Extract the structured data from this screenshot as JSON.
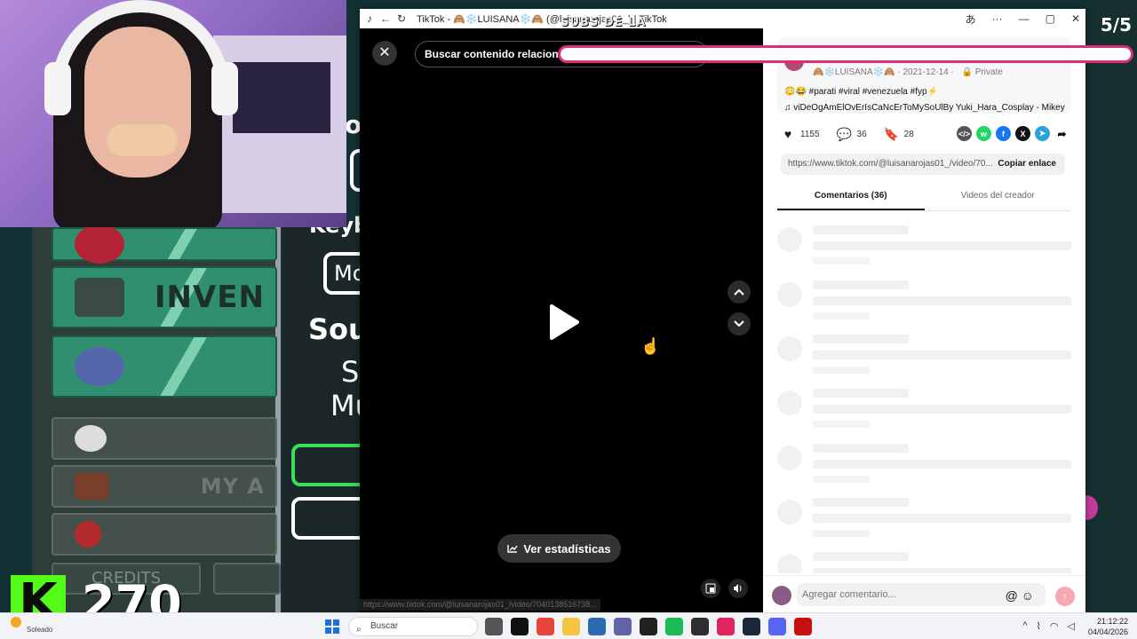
{
  "stream": {
    "counter": "5/5",
    "overlay_text": "SUBS DE LA",
    "viewer_count": "270",
    "kick_logo": "K",
    "game_menu": {
      "inventory_label": "INVEN",
      "my_label": "MY A",
      "credits_label": "CREDITS",
      "keyb_label": "Keyb",
      "mo_label": "Mo",
      "sou_label": "Sou",
      "s_label": "S",
      "mu_label": "Mu",
      "or_label": "or"
    }
  },
  "browser": {
    "title": "TikTok - 🙈❄️LUISANA❄️🙈 (@luisanarojas01_) | TikTok",
    "window_icons": [
      "translate-icon",
      "more-icon",
      "minimize-icon",
      "maximize-icon",
      "close-icon"
    ],
    "window_glyphs": {
      "translate": "あ",
      "more": "···",
      "minimize": "—",
      "maximize": "▢",
      "close": "✕"
    },
    "video": {
      "search_related": "Buscar contenido relacionado",
      "stats_button": "Ver estadísticas",
      "status_url": "https://www.tiktok.com/@luisanarojas01_/video/7040138516738..."
    },
    "side": {
      "meta_user": "🙈❄️LUISANA❄️🙈",
      "meta_date": "2021-12-14",
      "meta_privacy": "Private",
      "hashtags": "😳😂 #parati #viral #venezuela #fyp⚡",
      "music": "viDeOgAmElOvErIsCaNcErToMySoUlBy Yuki_Hara_Cosplay - Mikey",
      "likes": "1155",
      "comments": "36",
      "saves": "28",
      "link": "https://www.tiktok.com/@luisanarojas01_/video/70...",
      "copy_link": "Copiar enlace",
      "tabs": [
        "Comentarios (36)",
        "Videos del creador"
      ],
      "comment_placeholder": "Agregar comentario...",
      "comment_icons": "@ ☺"
    }
  },
  "taskbar": {
    "weather": "Soleado",
    "search": "Buscar",
    "time": "21:12:22",
    "date": "04/04/2026",
    "apps": [
      {
        "name": "file-explorer-app",
        "color": "#555"
      },
      {
        "name": "tiktok-app",
        "color": "#111"
      },
      {
        "name": "chrome-app",
        "color": "#e8453c"
      },
      {
        "name": "folder-app",
        "color": "#f4c542"
      },
      {
        "name": "store-app",
        "color": "#2b6cb0"
      },
      {
        "name": "teams-app",
        "color": "#6264a7"
      },
      {
        "name": "media-app",
        "color": "#222"
      },
      {
        "name": "spotify-app",
        "color": "#1db954"
      },
      {
        "name": "obs-app",
        "color": "#302e31"
      },
      {
        "name": "capcut-app",
        "color": "#e0245e"
      },
      {
        "name": "steam-app",
        "color": "#1b2838"
      },
      {
        "name": "discord-app",
        "color": "#5865f2"
      },
      {
        "name": "among-us-app",
        "color": "#c51111"
      }
    ]
  }
}
